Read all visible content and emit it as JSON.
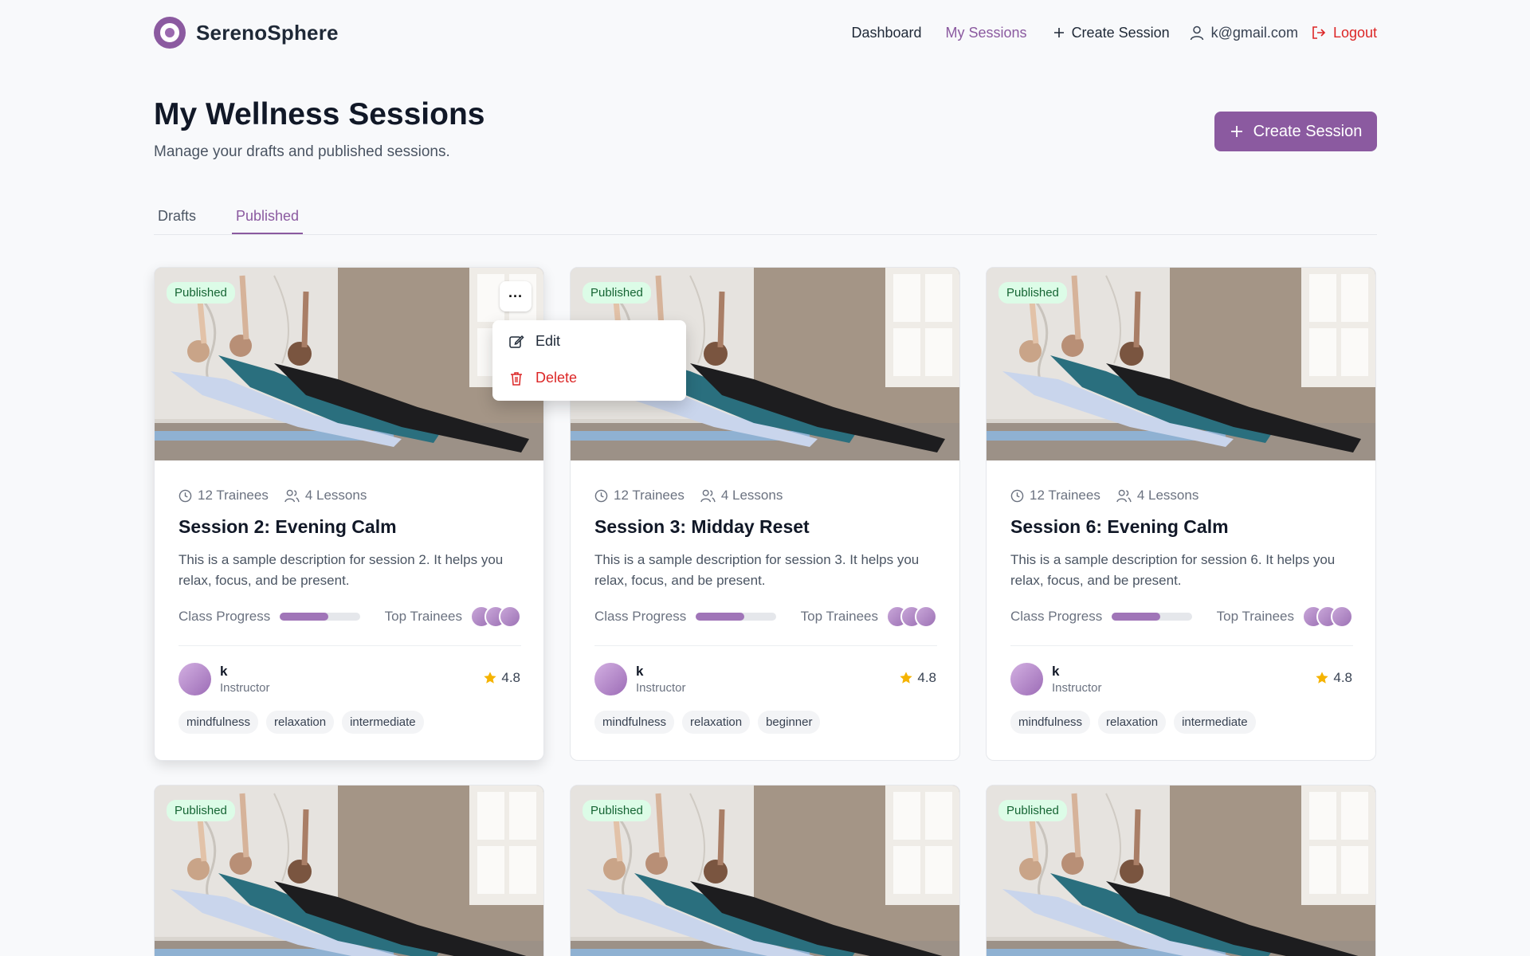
{
  "app": {
    "brand": "SerenoSphere"
  },
  "nav": {
    "dashboard": "Dashboard",
    "my_sessions": "My Sessions",
    "create_session": "Create Session",
    "user_email": "k@gmail.com",
    "logout": "Logout"
  },
  "header": {
    "title": "My Wellness Sessions",
    "subtitle": "Manage your drafts and published sessions.",
    "create_button": "Create Session"
  },
  "tabs": [
    {
      "label": "Drafts",
      "active": false
    },
    {
      "label": "Published",
      "active": true
    }
  ],
  "menu": {
    "edit": "Edit",
    "delete": "Delete"
  },
  "colors": {
    "accent": "#8b5aa0",
    "danger": "#dc2626",
    "badge_bg": "#dcfce7",
    "badge_text": "#166534",
    "star": "#f5b301"
  },
  "labels": {
    "class_progress": "Class Progress",
    "top_trainees": "Top Trainees",
    "instructor_role": "Instructor"
  },
  "cards": [
    {
      "status": "Published",
      "trainees": "12 Trainees",
      "lessons": "4 Lessons",
      "title": "Session 2: Evening Calm",
      "description": "This is a sample description for session 2. It helps you relax, focus, and be present.",
      "progress": 0.6,
      "instructor": "k",
      "rating": "4.8",
      "tags": [
        "mindfulness",
        "relaxation",
        "intermediate"
      ]
    },
    {
      "status": "Published",
      "trainees": "12 Trainees",
      "lessons": "4 Lessons",
      "title": "Session 3: Midday Reset",
      "description": "This is a sample description for session 3. It helps you relax, focus, and be present.",
      "progress": 0.6,
      "instructor": "k",
      "rating": "4.8",
      "tags": [
        "mindfulness",
        "relaxation",
        "beginner"
      ]
    },
    {
      "status": "Published",
      "trainees": "12 Trainees",
      "lessons": "4 Lessons",
      "title": "Session 6: Evening Calm",
      "description": "This is a sample description for session 6. It helps you relax, focus, and be present.",
      "progress": 0.6,
      "instructor": "k",
      "rating": "4.8",
      "tags": [
        "mindfulness",
        "relaxation",
        "intermediate"
      ]
    },
    {
      "status": "Published"
    },
    {
      "status": "Published"
    },
    {
      "status": "Published"
    }
  ]
}
